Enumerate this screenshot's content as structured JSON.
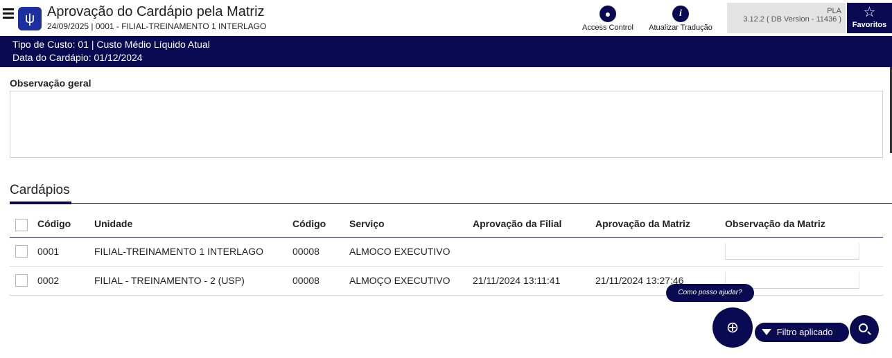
{
  "header": {
    "title": "Aprovação do Cardápio pela Matriz",
    "subtitle": "24/09/2025 | 0001 - FILIAL-TREINAMENTO 1 INTERLAGO",
    "app_icon": "fork-knife-icon",
    "actions": {
      "access_control": "Access Control",
      "atualizar_traducao": "Atualizar Tradução"
    },
    "version_line1": "PLA",
    "version_line2": "3.12.2 ( DB Version - 11436 )",
    "favoritos": "Favoritos"
  },
  "info": {
    "tipo_custo": "Tipo de Custo: 01 | Custo Médio Líquido Atual",
    "data_cardapio": "Data do Cardápio: 01/12/2024"
  },
  "observacao": {
    "label": "Observação geral",
    "value": ""
  },
  "section": {
    "title": "Cardápios"
  },
  "table": {
    "columns": [
      "Código",
      "Unidade",
      "Código",
      "Serviço",
      "Aprovação da Filial",
      "Aprovação da Matriz",
      "Observação da Matriz"
    ],
    "rows": [
      {
        "codigo": "0001",
        "unidade": "FILIAL-TREINAMENTO 1 INTERLAGO",
        "codigo2": "00008",
        "servico": "ALMOCO EXECUTIVO",
        "aprov_filial": "",
        "aprov_matriz": "",
        "obs_matriz": ""
      },
      {
        "codigo": "0002",
        "unidade": "FILIAL - TREINAMENTO - 2 (USP)",
        "codigo2": "00008",
        "servico": "ALMOÇO EXECUTIVO",
        "aprov_filial": "21/11/2024 13:11:41",
        "aprov_matriz": "21/11/2024 13:27:46",
        "obs_matriz": ""
      }
    ]
  },
  "widgets": {
    "help_bubble": "Como posso ajudar?",
    "filter_label": "Filtro aplicado"
  },
  "colors": {
    "primary": "#0a0a52",
    "app_icon_bg": "#1b2f9e",
    "version_bg": "#e3e3e3"
  }
}
